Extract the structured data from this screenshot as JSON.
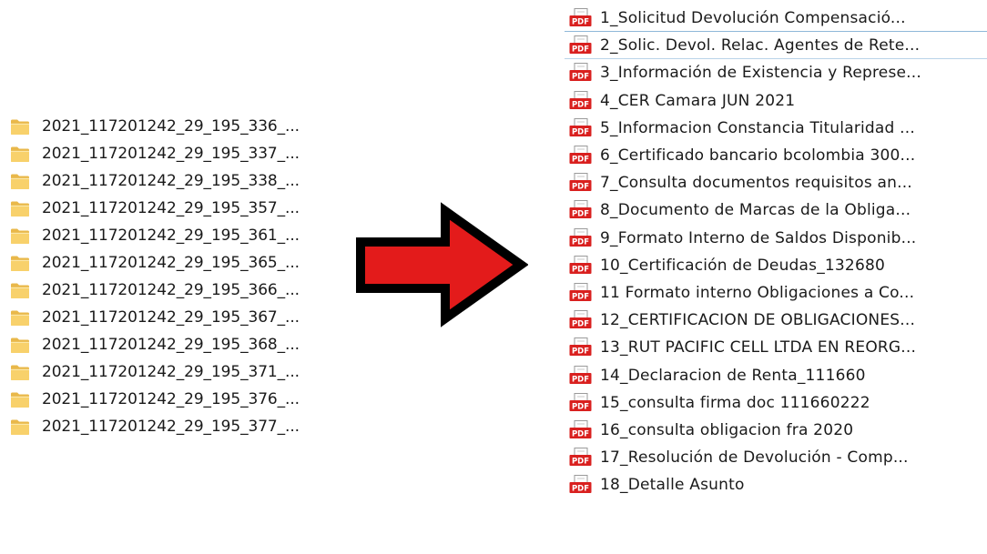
{
  "left_panel": {
    "folders": [
      {
        "name": "2021_117201242_29_195_336_...",
        "icon": "folder-icon"
      },
      {
        "name": "2021_117201242_29_195_337_...",
        "icon": "folder-icon"
      },
      {
        "name": "2021_117201242_29_195_338_...",
        "icon": "folder-icon"
      },
      {
        "name": "2021_117201242_29_195_357_...",
        "icon": "folder-icon"
      },
      {
        "name": "2021_117201242_29_195_361_...",
        "icon": "folder-icon"
      },
      {
        "name": "2021_117201242_29_195_365_...",
        "icon": "folder-icon"
      },
      {
        "name": "2021_117201242_29_195_366_...",
        "icon": "folder-icon"
      },
      {
        "name": "2021_117201242_29_195_367_...",
        "icon": "folder-icon"
      },
      {
        "name": "2021_117201242_29_195_368_...",
        "icon": "folder-icon"
      },
      {
        "name": "2021_117201242_29_195_371_...",
        "icon": "folder-icon"
      },
      {
        "name": "2021_117201242_29_195_376_...",
        "icon": "folder-icon"
      },
      {
        "name": "2021_117201242_29_195_377_...",
        "icon": "folder-icon"
      }
    ]
  },
  "arrow": {
    "icon": "right-arrow-icon",
    "fill_color": "#e31b1b",
    "stroke_color": "#000000"
  },
  "right_panel": {
    "files": [
      {
        "name": "1_Solicitud Devolución Compensació...",
        "icon": "pdf-file-icon"
      },
      {
        "name": "2_Solic. Devol. Relac. Agentes de Rete...",
        "icon": "pdf-file-icon"
      },
      {
        "name": "3_Información de Existencia y Represe...",
        "icon": "pdf-file-icon"
      },
      {
        "name": "4_CER Camara JUN 2021",
        "icon": "pdf-file-icon"
      },
      {
        "name": "5_Informacion Constancia Titularidad ...",
        "icon": "pdf-file-icon"
      },
      {
        "name": "6_Certificado bancario bcolombia 300...",
        "icon": "pdf-file-icon"
      },
      {
        "name": "7_Consulta documentos requisitos an...",
        "icon": "pdf-file-icon"
      },
      {
        "name": "8_Documento de Marcas de la Obliga...",
        "icon": "pdf-file-icon"
      },
      {
        "name": "9_Formato Interno de Saldos Disponib...",
        "icon": "pdf-file-icon"
      },
      {
        "name": "10_Certificación de Deudas_132680",
        "icon": "pdf-file-icon"
      },
      {
        "name": "11 Formato interno Obligaciones a Co...",
        "icon": "pdf-file-icon"
      },
      {
        "name": "12_CERTIFICACION DE OBLIGACIONES...",
        "icon": "pdf-file-icon"
      },
      {
        "name": "13_RUT PACIFIC CELL LTDA EN REORG...",
        "icon": "pdf-file-icon"
      },
      {
        "name": "14_Declaracion de Renta_111660",
        "icon": "pdf-file-icon"
      },
      {
        "name": "15_consulta firma doc 111660222",
        "icon": "pdf-file-icon"
      },
      {
        "name": "16_consulta obligacion fra 2020",
        "icon": "pdf-file-icon"
      },
      {
        "name": "17_Resolución de Devolución - Comp...",
        "icon": "pdf-file-icon"
      },
      {
        "name": "18_Detalle Asunto",
        "icon": "pdf-file-icon"
      }
    ],
    "pdf_icon_label": "PDF",
    "pdf_icon_color": "#d9201f"
  },
  "colors": {
    "folder_front": "#f8d16b",
    "folder_back": "#e9b84a",
    "selection_border": "#8fb7d8"
  }
}
